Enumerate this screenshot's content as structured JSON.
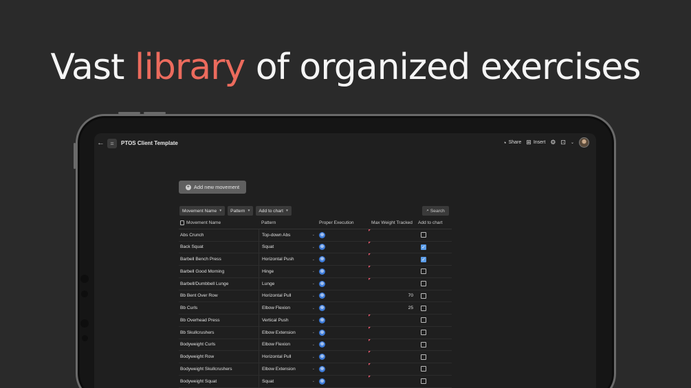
{
  "headline": {
    "pre": "Vast ",
    "accent": "library",
    "post": " of organized exercises"
  },
  "app": {
    "title": "PTOS Client Template",
    "share_label": "Share",
    "insert_label": "Insert",
    "add_button_label": "Add new movement",
    "filters": [
      "Movement Name",
      "Pattern",
      "Add to chart"
    ],
    "search_label": "Search"
  },
  "table": {
    "columns": [
      "Movement Name",
      "Pattern",
      "Proper Execution",
      "Max Weight Tracked",
      "Add to chart"
    ],
    "rows": [
      {
        "name": "Abs Crunch",
        "pattern": "Top-down Abs",
        "max": "",
        "checked": false
      },
      {
        "name": "Back Squat",
        "pattern": "Squat",
        "max": "",
        "checked": true
      },
      {
        "name": "Barbell Bench Press",
        "pattern": "Horizontal Push",
        "max": "",
        "checked": true
      },
      {
        "name": "Barbell Good Morning",
        "pattern": "Hinge",
        "max": "",
        "checked": false
      },
      {
        "name": "Barbell/Dumbbell Lunge",
        "pattern": "Lunge",
        "max": "",
        "checked": false
      },
      {
        "name": "Bb Bent Over Row",
        "pattern": "Horizontal Pull",
        "max": "70",
        "checked": false
      },
      {
        "name": "Bb Curls",
        "pattern": "Elbow Flexion",
        "max": "25",
        "checked": false
      },
      {
        "name": "Bb Overhead Press",
        "pattern": "Vertical Push",
        "max": "",
        "checked": false
      },
      {
        "name": "Bb Skullcrushers",
        "pattern": "Elbow Extension",
        "max": "",
        "checked": false
      },
      {
        "name": "Bodyweight Curls",
        "pattern": "Elbow Flexion",
        "max": "",
        "checked": false
      },
      {
        "name": "Bodyweight Row",
        "pattern": "Horizontal Pull",
        "max": "",
        "checked": false
      },
      {
        "name": "Bodyweight Skullcrushers",
        "pattern": "Elbow Extension",
        "max": "",
        "checked": false
      },
      {
        "name": "Bodyweight Squat",
        "pattern": "Squat",
        "max": "",
        "checked": false
      }
    ]
  },
  "colors": {
    "accent": "#ec6b5d",
    "checkbox": "#5b9ce8",
    "globe": "#3d7bd9"
  }
}
